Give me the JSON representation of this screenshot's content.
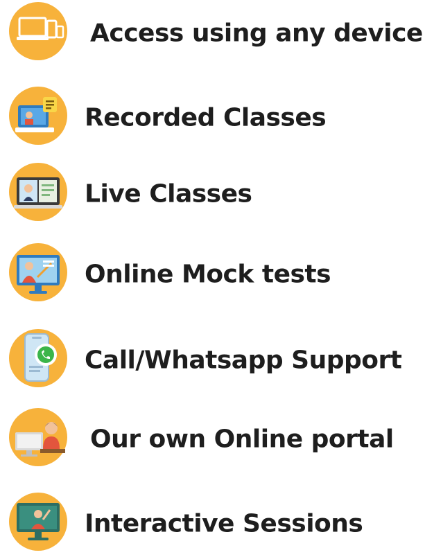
{
  "features": [
    {
      "label": "Access using any device",
      "icon": "devices-icon"
    },
    {
      "label": "Recorded Classes",
      "icon": "recorded-classes-icon"
    },
    {
      "label": "Live Classes",
      "icon": "live-classes-icon"
    },
    {
      "label": "Online Mock tests",
      "icon": "mock-tests-icon"
    },
    {
      "label": "Call/Whatsapp Support",
      "icon": "whatsapp-phone-icon"
    },
    {
      "label": "Our own Online portal",
      "icon": "online-portal-icon"
    },
    {
      "label": "Interactive Sessions",
      "icon": "interactive-sessions-icon"
    }
  ],
  "colors": {
    "icon_circle": "#f7b23b",
    "text": "#1e1e1e"
  }
}
